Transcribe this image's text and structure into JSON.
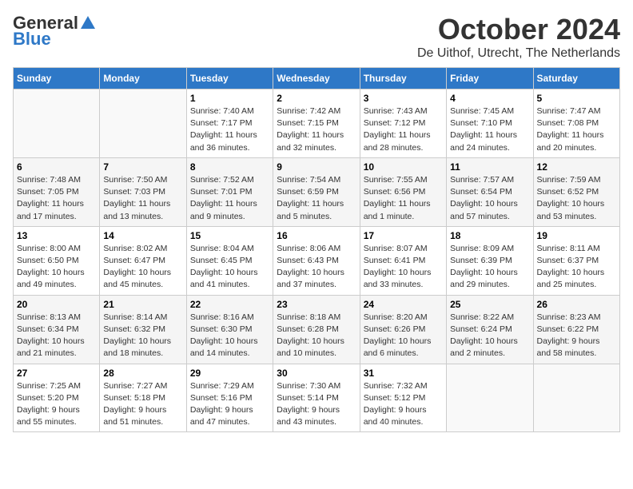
{
  "header": {
    "logo_general": "General",
    "logo_blue": "Blue",
    "month": "October 2024",
    "location": "De Uithof, Utrecht, The Netherlands"
  },
  "weekdays": [
    "Sunday",
    "Monday",
    "Tuesday",
    "Wednesday",
    "Thursday",
    "Friday",
    "Saturday"
  ],
  "weeks": [
    [
      {
        "day": "",
        "info": ""
      },
      {
        "day": "",
        "info": ""
      },
      {
        "day": "1",
        "info": "Sunrise: 7:40 AM\nSunset: 7:17 PM\nDaylight: 11 hours\nand 36 minutes."
      },
      {
        "day": "2",
        "info": "Sunrise: 7:42 AM\nSunset: 7:15 PM\nDaylight: 11 hours\nand 32 minutes."
      },
      {
        "day": "3",
        "info": "Sunrise: 7:43 AM\nSunset: 7:12 PM\nDaylight: 11 hours\nand 28 minutes."
      },
      {
        "day": "4",
        "info": "Sunrise: 7:45 AM\nSunset: 7:10 PM\nDaylight: 11 hours\nand 24 minutes."
      },
      {
        "day": "5",
        "info": "Sunrise: 7:47 AM\nSunset: 7:08 PM\nDaylight: 11 hours\nand 20 minutes."
      }
    ],
    [
      {
        "day": "6",
        "info": "Sunrise: 7:48 AM\nSunset: 7:05 PM\nDaylight: 11 hours\nand 17 minutes."
      },
      {
        "day": "7",
        "info": "Sunrise: 7:50 AM\nSunset: 7:03 PM\nDaylight: 11 hours\nand 13 minutes."
      },
      {
        "day": "8",
        "info": "Sunrise: 7:52 AM\nSunset: 7:01 PM\nDaylight: 11 hours\nand 9 minutes."
      },
      {
        "day": "9",
        "info": "Sunrise: 7:54 AM\nSunset: 6:59 PM\nDaylight: 11 hours\nand 5 minutes."
      },
      {
        "day": "10",
        "info": "Sunrise: 7:55 AM\nSunset: 6:56 PM\nDaylight: 11 hours\nand 1 minute."
      },
      {
        "day": "11",
        "info": "Sunrise: 7:57 AM\nSunset: 6:54 PM\nDaylight: 10 hours\nand 57 minutes."
      },
      {
        "day": "12",
        "info": "Sunrise: 7:59 AM\nSunset: 6:52 PM\nDaylight: 10 hours\nand 53 minutes."
      }
    ],
    [
      {
        "day": "13",
        "info": "Sunrise: 8:00 AM\nSunset: 6:50 PM\nDaylight: 10 hours\nand 49 minutes."
      },
      {
        "day": "14",
        "info": "Sunrise: 8:02 AM\nSunset: 6:47 PM\nDaylight: 10 hours\nand 45 minutes."
      },
      {
        "day": "15",
        "info": "Sunrise: 8:04 AM\nSunset: 6:45 PM\nDaylight: 10 hours\nand 41 minutes."
      },
      {
        "day": "16",
        "info": "Sunrise: 8:06 AM\nSunset: 6:43 PM\nDaylight: 10 hours\nand 37 minutes."
      },
      {
        "day": "17",
        "info": "Sunrise: 8:07 AM\nSunset: 6:41 PM\nDaylight: 10 hours\nand 33 minutes."
      },
      {
        "day": "18",
        "info": "Sunrise: 8:09 AM\nSunset: 6:39 PM\nDaylight: 10 hours\nand 29 minutes."
      },
      {
        "day": "19",
        "info": "Sunrise: 8:11 AM\nSunset: 6:37 PM\nDaylight: 10 hours\nand 25 minutes."
      }
    ],
    [
      {
        "day": "20",
        "info": "Sunrise: 8:13 AM\nSunset: 6:34 PM\nDaylight: 10 hours\nand 21 minutes."
      },
      {
        "day": "21",
        "info": "Sunrise: 8:14 AM\nSunset: 6:32 PM\nDaylight: 10 hours\nand 18 minutes."
      },
      {
        "day": "22",
        "info": "Sunrise: 8:16 AM\nSunset: 6:30 PM\nDaylight: 10 hours\nand 14 minutes."
      },
      {
        "day": "23",
        "info": "Sunrise: 8:18 AM\nSunset: 6:28 PM\nDaylight: 10 hours\nand 10 minutes."
      },
      {
        "day": "24",
        "info": "Sunrise: 8:20 AM\nSunset: 6:26 PM\nDaylight: 10 hours\nand 6 minutes."
      },
      {
        "day": "25",
        "info": "Sunrise: 8:22 AM\nSunset: 6:24 PM\nDaylight: 10 hours\nand 2 minutes."
      },
      {
        "day": "26",
        "info": "Sunrise: 8:23 AM\nSunset: 6:22 PM\nDaylight: 9 hours\nand 58 minutes."
      }
    ],
    [
      {
        "day": "27",
        "info": "Sunrise: 7:25 AM\nSunset: 5:20 PM\nDaylight: 9 hours\nand 55 minutes."
      },
      {
        "day": "28",
        "info": "Sunrise: 7:27 AM\nSunset: 5:18 PM\nDaylight: 9 hours\nand 51 minutes."
      },
      {
        "day": "29",
        "info": "Sunrise: 7:29 AM\nSunset: 5:16 PM\nDaylight: 9 hours\nand 47 minutes."
      },
      {
        "day": "30",
        "info": "Sunrise: 7:30 AM\nSunset: 5:14 PM\nDaylight: 9 hours\nand 43 minutes."
      },
      {
        "day": "31",
        "info": "Sunrise: 7:32 AM\nSunset: 5:12 PM\nDaylight: 9 hours\nand 40 minutes."
      },
      {
        "day": "",
        "info": ""
      },
      {
        "day": "",
        "info": ""
      }
    ]
  ]
}
